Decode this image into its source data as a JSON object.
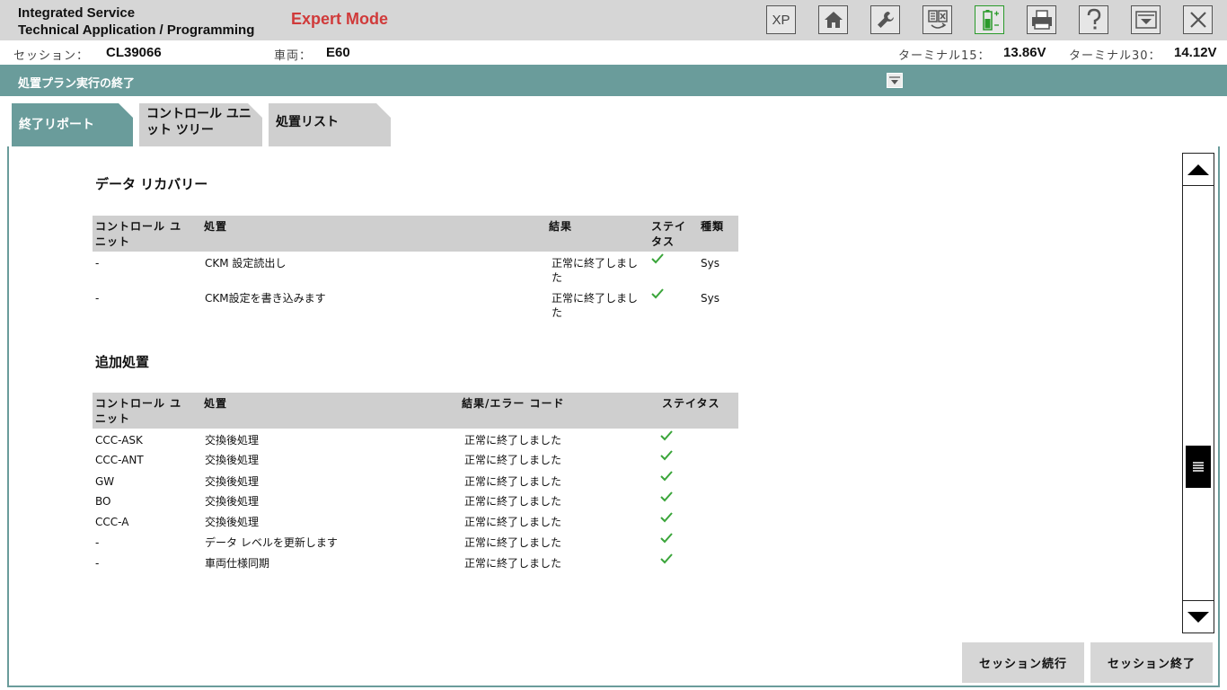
{
  "app": {
    "title_line1": "Integrated Service",
    "title_line2": "Technical Application / Programming",
    "mode": "Expert Mode"
  },
  "toolbar": {
    "xp_label": "XP",
    "icons": [
      "home-icon",
      "wrench-icon",
      "swap-icon",
      "battery-icon",
      "printer-icon",
      "help-icon",
      "download-icon",
      "close-icon"
    ]
  },
  "info": {
    "session_label": "セッション：",
    "session_value": "CL39066",
    "vehicle_label": "車両：",
    "vehicle_value": "E60",
    "terminal15_label": "ターミナル15：",
    "terminal15_value": "13.86V",
    "terminal30_label": "ターミナル30：",
    "terminal30_value": "14.12V"
  },
  "section": {
    "title": "処置プラン実行の終了"
  },
  "tabs": [
    {
      "label": "終了リポート"
    },
    {
      "label": "コントロール ユニット ツリー"
    },
    {
      "label": "処置リスト"
    }
  ],
  "recovery": {
    "heading": "データ リカバリー",
    "columns": {
      "unit": "コントロール ユニット",
      "action": "処置",
      "result": "結果",
      "status": "ステイタス",
      "type": "種類"
    },
    "rows": [
      {
        "unit": "-",
        "action": "CKM 設定読出し",
        "result": "正常に終了しました",
        "type": "Sys"
      },
      {
        "unit": "-",
        "action": "CKM設定を書き込みます",
        "result": "正常に終了しました",
        "type": "Sys"
      }
    ]
  },
  "additional": {
    "heading": "追加処置",
    "columns": {
      "unit": "コントロール ユニット",
      "action": "処置",
      "result": "結果/エラー コード",
      "status": "ステイタス"
    },
    "rows": [
      {
        "unit": "CCC-ASK",
        "action": "交換後処理",
        "result": "正常に終了しました"
      },
      {
        "unit": "CCC-ANT",
        "action": "交換後処理",
        "result": "正常に終了しました"
      },
      {
        "unit": "GW",
        "action": "交換後処理",
        "result": "正常に終了しました"
      },
      {
        "unit": "BO",
        "action": "交換後処理",
        "result": "正常に終了しました"
      },
      {
        "unit": "CCC-A",
        "action": "交換後処理",
        "result": "正常に終了しました"
      },
      {
        "unit": "-",
        "action": "データ レベルを更新します",
        "result": "正常に終了しました"
      },
      {
        "unit": "-",
        "action": "車両仕様同期",
        "result": "正常に終了しました"
      }
    ]
  },
  "footer": {
    "continue_label": "セッション続行",
    "end_label": "セッション終了"
  },
  "colors": {
    "accent": "#6a9c9b",
    "check": "#3aa53a",
    "mode": "#d03a3a"
  }
}
